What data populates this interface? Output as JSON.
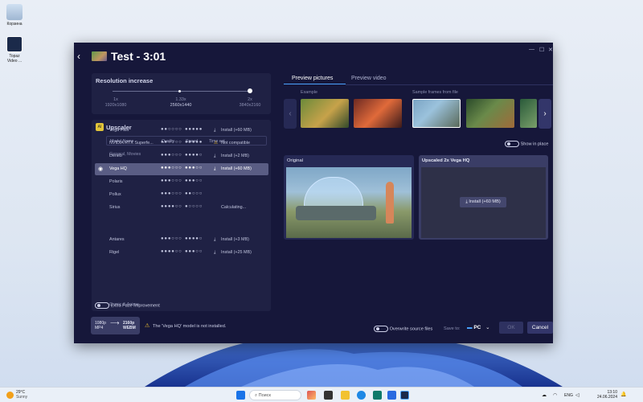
{
  "desktop": {
    "icons": [
      {
        "label": "Корзина"
      },
      {
        "label": "Topaz Video ..."
      }
    ]
  },
  "window": {
    "title": "Test - 3:01",
    "controls": {
      "minimize": "—",
      "maximize": "☐",
      "close": "✕"
    }
  },
  "resolution": {
    "heading": "Resolution increase",
    "stops": [
      {
        "factor": "1x",
        "res": "1920x1080"
      },
      {
        "factor": "1.33x",
        "res": "2560x1440"
      },
      {
        "factor": "2x",
        "res": "3840x2160"
      }
    ]
  },
  "upscaler": {
    "heading": "Upscaler",
    "columns": [
      "Model Name",
      "Quality",
      "Speed",
      "Time est."
    ],
    "group1": "General, Movies",
    "group2": "Comic & Anime",
    "models": [
      {
        "name": "Vega Fast",
        "quality": "●●○○○○",
        "speed": "●●●●●",
        "status": "Install (+60 MB)"
      },
      {
        "name": "NVIDIA RTX Superfe...",
        "quality": "●●○○○○",
        "speed": "●●●●●",
        "status": "Not compatible"
      },
      {
        "name": "Deneb",
        "quality": "●●●○○○",
        "speed": "●●●●○",
        "status": "Install (+2 MB)"
      },
      {
        "name": "Vega HQ",
        "quality": "●●●○○○",
        "speed": "●●●○○",
        "status": "Install (+60 MB)"
      },
      {
        "name": "Polaris",
        "quality": "●●●○○○",
        "speed": "●●●○○",
        "status": ""
      },
      {
        "name": "Pollux",
        "quality": "●●●○○○",
        "speed": "●●○○○",
        "status": ""
      },
      {
        "name": "Sirius",
        "quality": "●●●●○○",
        "speed": "●○○○○",
        "status": "Calculating..."
      },
      {
        "name": "Antares",
        "quality": "●●●○○○",
        "speed": "●●●●○",
        "status": "Install (+3 MB)"
      },
      {
        "name": "Rigel",
        "quality": "●●●●○○",
        "speed": "●●●○○",
        "status": "Install (+25 MB)"
      }
    ],
    "face_toggle": "Extra Face Improvement"
  },
  "preview": {
    "tabs": [
      "Preview pictures",
      "Preview video"
    ],
    "example_label": "Example",
    "samples_label": "Sample frames from file",
    "show_in_place": "Show in place",
    "original_label": "Original",
    "upscaled_label": "Upscaled 2x Vega HQ",
    "install_button": "Install (+60 MB)"
  },
  "footer": {
    "from_res": "1080p",
    "from_fmt": "MP4",
    "to_res": "2160p",
    "to_fmt": "WEBM",
    "warning": "The 'Vega HQ' model is not installed.",
    "overwrite": "Overwrite source files",
    "save_to_label": "Save to:",
    "save_to_value": "PC",
    "ok": "OK",
    "cancel": "Cancel"
  },
  "taskbar": {
    "weather_temp": "29°C",
    "weather_desc": "Sunny",
    "search_placeholder": "Поиск",
    "lang": "ENG",
    "time": "13:10",
    "date": "24.06.2024"
  },
  "colors": {
    "accent": "#4aa3ff",
    "warning": "#f2c230",
    "window_bg": "#16173a",
    "panel_bg": "#1f2144"
  }
}
